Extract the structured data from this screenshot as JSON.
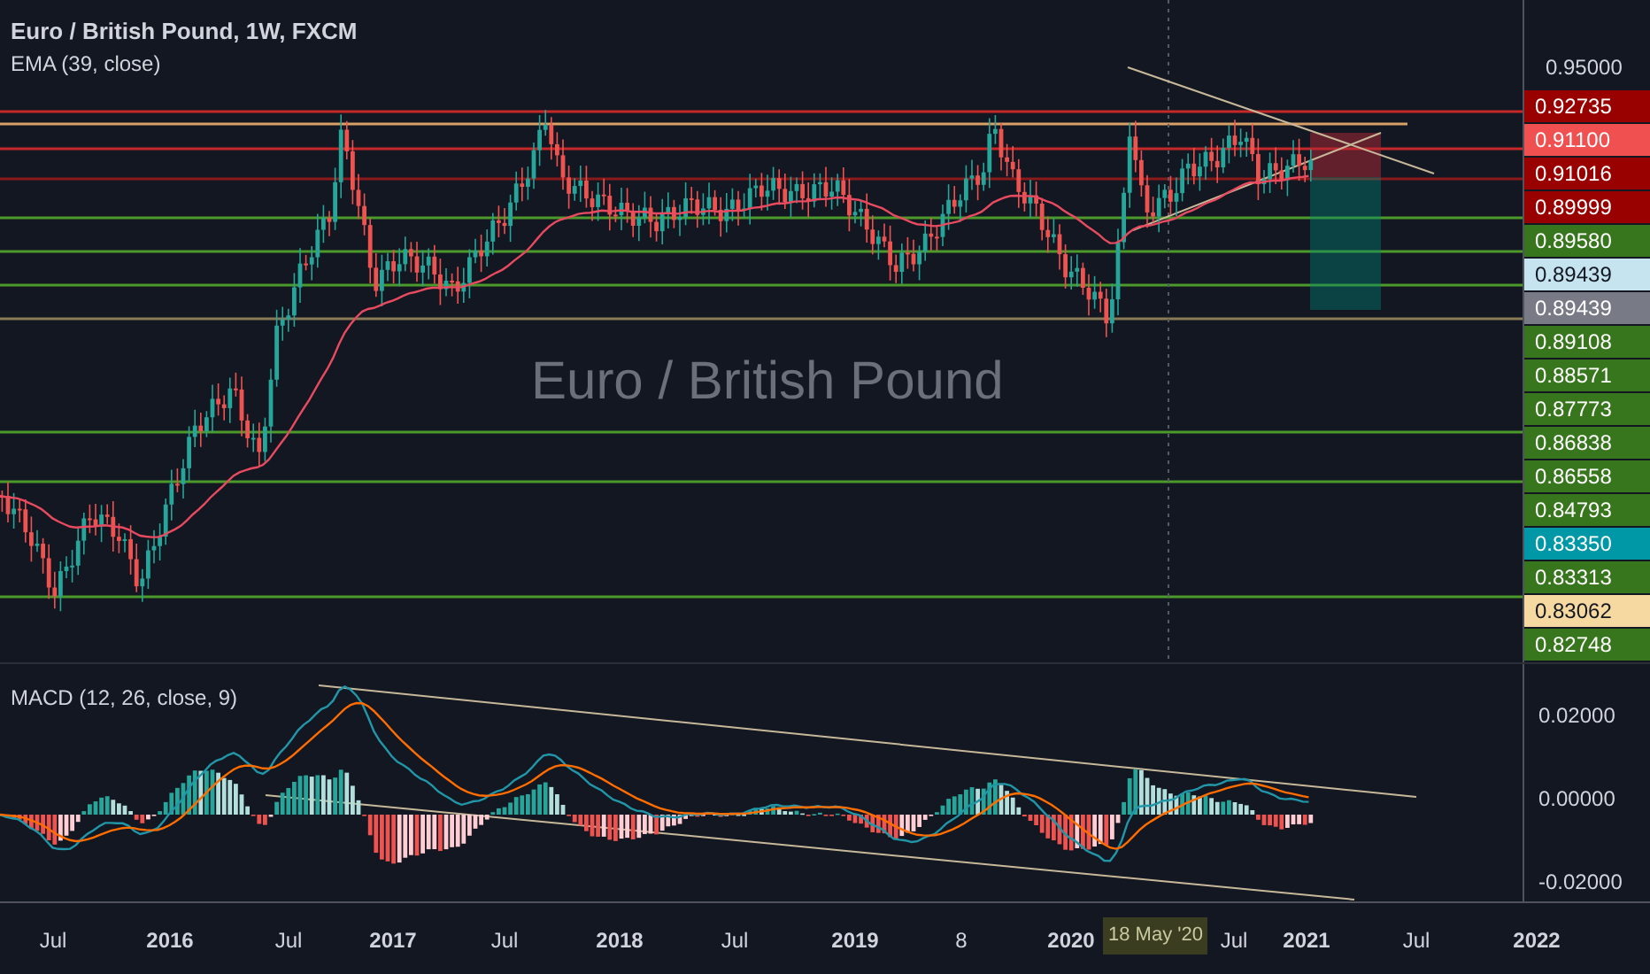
{
  "legend": {
    "title": "Euro / British Pound, 1W, FXCM",
    "indicator": "EMA (39, close)"
  },
  "symbol_watermark": "Euro / British Pound",
  "price_axis": {
    "tick": "0.95000",
    "labels": [
      {
        "text": "0.92735",
        "color": "#990000"
      },
      {
        "text": "0.91100",
        "color": "#f05050"
      },
      {
        "text": "0.91016",
        "color": "#990000"
      },
      {
        "text": "0.89999",
        "color": "#990000"
      },
      {
        "text": "0.89580",
        "color": "#38761d"
      },
      {
        "text": "0.89439",
        "color": "#c5e4ef"
      },
      {
        "text": "0.89439",
        "color": "#787b86"
      },
      {
        "text": "0.89108",
        "color": "#38761d"
      },
      {
        "text": "0.88571",
        "color": "#38761d"
      },
      {
        "text": "0.87773",
        "color": "#38761d"
      },
      {
        "text": "0.86838",
        "color": "#38761d"
      },
      {
        "text": "0.86558",
        "color": "#38761d"
      },
      {
        "text": "0.84793",
        "color": "#38761d"
      },
      {
        "text": "0.83350",
        "color": "#0097a7"
      },
      {
        "text": "0.83313",
        "color": "#38761d"
      },
      {
        "text": "0.83062",
        "color": "#f6d9a0"
      },
      {
        "text": "0.82748",
        "color": "#38761d"
      }
    ]
  },
  "macd": {
    "title": "MACD (12, 26, close, 9)",
    "ticks": [
      "0.02000",
      "0.00000",
      "-0.02000"
    ]
  },
  "time_axis": {
    "labels": [
      "Jul",
      "2016",
      "Jul",
      "2017",
      "Jul",
      "2018",
      "Jul",
      "2019",
      "8",
      "2020",
      "Jul",
      "2021",
      "Jul",
      "2022"
    ],
    "crosshair_label": "18 May '20"
  }
}
